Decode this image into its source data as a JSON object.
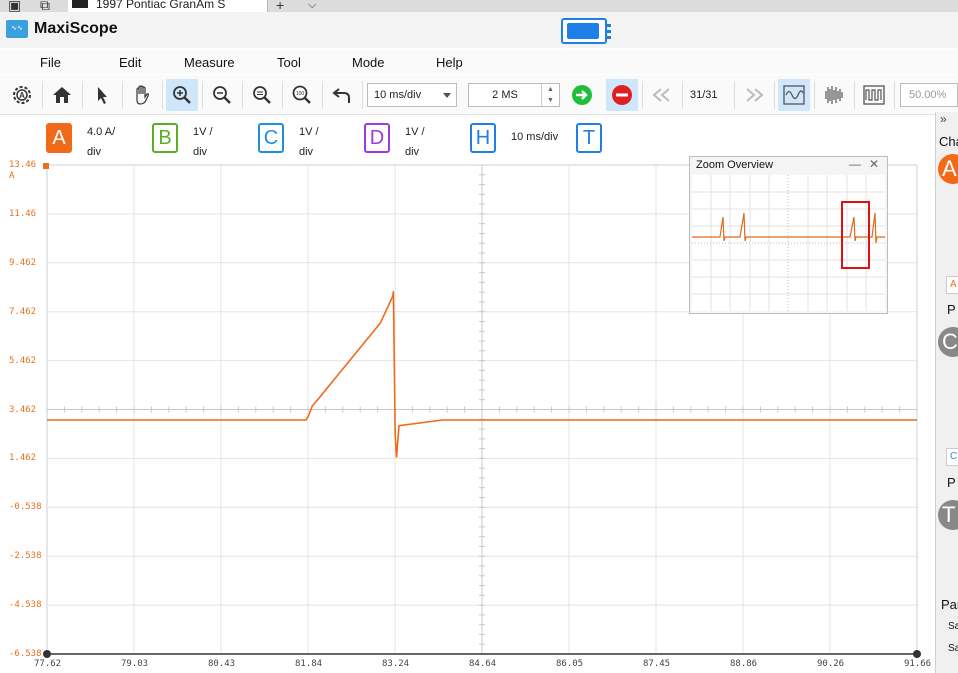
{
  "tab": {
    "title": "1997 Pontiac GranAm S"
  },
  "app": {
    "title": "MaxiScope"
  },
  "menu": [
    "File",
    "Edit",
    "Measure",
    "Tool",
    "Mode",
    "Help"
  ],
  "toolbar": {
    "timebase": "10  ms/div",
    "samples": "2 MS",
    "page": "31/31",
    "zoom": "50.00%"
  },
  "channels": [
    {
      "id": "A",
      "scale_line1": "4.0 A/",
      "scale_line2": "div",
      "color": "#f06a1a",
      "filled": true
    },
    {
      "id": "B",
      "scale_line1": "1V /",
      "scale_line2": "div",
      "color": "#5aae2a",
      "filled": false
    },
    {
      "id": "C",
      "scale_line1": "1V /",
      "scale_line2": "div",
      "color": "#1e90e0",
      "filled": false
    },
    {
      "id": "D",
      "scale_line1": "1V /",
      "scale_line2": "div",
      "color": "#9a3adf",
      "filled": false
    },
    {
      "id": "H",
      "scale_line1": "10  ms/div",
      "scale_line2": "",
      "color": "#1e7fe8",
      "filled": false
    },
    {
      "id": "T",
      "scale_line1": "",
      "scale_line2": "",
      "color": "#1e7fe8",
      "filled": false
    }
  ],
  "y_axis": {
    "top_unit": "A",
    "labels": [
      "13.46",
      "11.46",
      "9.462",
      "7.462",
      "5.462",
      "3.462",
      "1.462",
      "-0.538",
      "-2.538",
      "-4.538",
      "-6.538"
    ]
  },
  "x_axis": {
    "labels": [
      "77.62",
      "79.03",
      "80.43",
      "81.84",
      "83.24",
      "84.64",
      "86.05",
      "87.45",
      "88.86",
      "90.26",
      "91.66"
    ]
  },
  "chart_data": {
    "type": "line",
    "title": "",
    "xlabel": "",
    "ylabel": "A",
    "xlim": [
      77.62,
      91.66
    ],
    "ylim": [
      -6.538,
      13.46
    ],
    "series": [
      {
        "name": "A",
        "color": "#f06a1a",
        "x": [
          77.62,
          81.8,
          81.84,
          81.9,
          82.0,
          83.0,
          83.2,
          83.21,
          83.24,
          83.26,
          83.3,
          84.0,
          85.0,
          91.66
        ],
        "y": [
          3.03,
          3.03,
          3.2,
          3.6,
          3.9,
          7.0,
          8.1,
          8.3,
          2.4,
          1.5,
          2.8,
          3.03,
          3.03,
          3.03
        ]
      }
    ]
  },
  "zoom_overview": {
    "title": "Zoom Overview",
    "min_glyph": "—",
    "close_glyph": "✕"
  },
  "right_panel": {
    "header": "Cha",
    "letters": [
      "A",
      "C",
      "T"
    ],
    "p1": "P",
    "p2": "P",
    "params": "Par",
    "s1": "Sa",
    "s2": "Sa",
    "box1": "A",
    "box2": "C"
  }
}
